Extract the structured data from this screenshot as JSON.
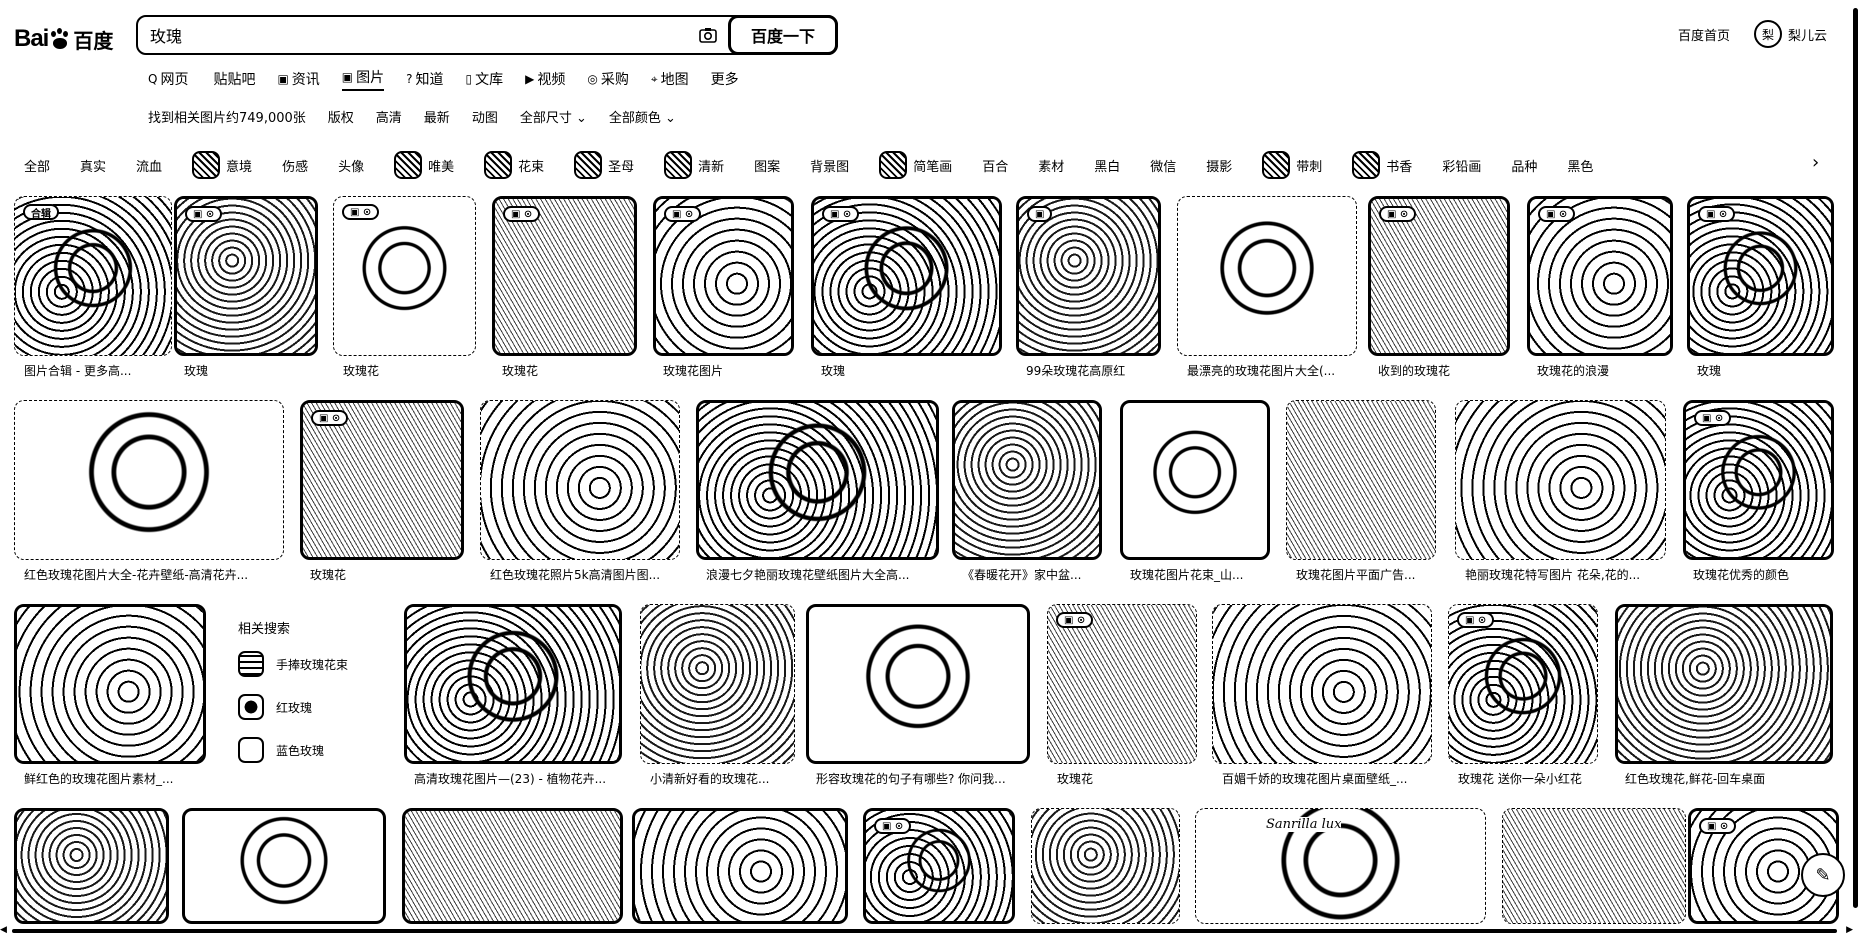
{
  "logo": {
    "bai": "Bai",
    "du": "百度"
  },
  "search": {
    "value": "玫瑰",
    "button_label": "百度一下"
  },
  "header": {
    "home_link": "百度首页",
    "username": "梨儿云",
    "avatar_text": "梨"
  },
  "nav": {
    "tabs": [
      {
        "label": "网页",
        "icon": "Q"
      },
      {
        "label": "贴贴吧",
        "icon": ""
      },
      {
        "label": "资讯",
        "icon": "▣"
      },
      {
        "label": "图片",
        "icon": "▣"
      },
      {
        "label": "知道",
        "icon": "?"
      },
      {
        "label": "文库",
        "icon": "▯"
      },
      {
        "label": "视频",
        "icon": "▶"
      },
      {
        "label": "采购",
        "icon": "◎"
      },
      {
        "label": "地图",
        "icon": "⌖"
      },
      {
        "label": "更多",
        "icon": ""
      }
    ]
  },
  "filters": {
    "result_count": "找到相关图片约749,000张",
    "items": [
      "版权",
      "高清",
      "最新",
      "动图",
      "全部尺寸 ⌄",
      "全部颜色 ⌄"
    ]
  },
  "tags": [
    {
      "label": "全部",
      "thumb": false
    },
    {
      "label": "真实",
      "thumb": false
    },
    {
      "label": "流血",
      "thumb": false
    },
    {
      "label": "意境",
      "thumb": true
    },
    {
      "label": "伤感",
      "thumb": false
    },
    {
      "label": "头像",
      "thumb": false
    },
    {
      "label": "唯美",
      "thumb": true
    },
    {
      "label": "花束",
      "thumb": true
    },
    {
      "label": "圣母",
      "thumb": true
    },
    {
      "label": "清新",
      "thumb": true
    },
    {
      "label": "图案",
      "thumb": false
    },
    {
      "label": "背景图",
      "thumb": false
    },
    {
      "label": "简笔画",
      "thumb": true
    },
    {
      "label": "百合",
      "thumb": false
    },
    {
      "label": "素材",
      "thumb": false
    },
    {
      "label": "黑白",
      "thumb": false
    },
    {
      "label": "微信",
      "thumb": false
    },
    {
      "label": "摄影",
      "thumb": false
    },
    {
      "label": "带刺",
      "thumb": true
    },
    {
      "label": "书香",
      "thumb": true
    },
    {
      "label": "彩铅画",
      "thumb": false
    },
    {
      "label": "品种",
      "thumb": false
    },
    {
      "label": "黑色",
      "thumb": false
    }
  ],
  "tags_arrow": "›",
  "row1": [
    {
      "caption": "图片合辑 - 更多高...",
      "badge": "合辑"
    },
    {
      "caption": "玫瑰",
      "badge": "▣ ⊙"
    },
    {
      "caption": "玫瑰花",
      "badge": "▣ ⊙"
    },
    {
      "caption": "玫瑰花",
      "badge": "▣ ⊙"
    },
    {
      "caption": "玫瑰花图片",
      "badge": "▣ ⊙"
    },
    {
      "caption": "玫瑰",
      "badge": "▣ ⊙"
    },
    {
      "caption": "99朵玫瑰花高原红",
      "badge": "▣"
    },
    {
      "caption": "最漂亮的玫瑰花图片大全(...",
      "badge": ""
    },
    {
      "caption": "收到的玫瑰花",
      "badge": "▣ ⊙"
    },
    {
      "caption": "玫瑰花的浪漫",
      "badge": "▣ ⊙"
    },
    {
      "caption": "玫瑰",
      "badge": "▣ ⊙"
    }
  ],
  "row2": [
    {
      "caption": "红色玫瑰花图片大全-花卉壁纸-高清花卉...",
      "badge": ""
    },
    {
      "caption": "玫瑰花",
      "badge": "▣ ⊙"
    },
    {
      "caption": "红色玫瑰花照片5k高清图片图...",
      "badge": ""
    },
    {
      "caption": "浪漫七夕艳丽玫瑰花壁纸图片大全高...",
      "badge": ""
    },
    {
      "caption": "《春暖花开》家中盆...",
      "badge": ""
    },
    {
      "caption": "玫瑰花图片花束_山...",
      "badge": ""
    },
    {
      "caption": "玫瑰花图片平面广告...",
      "badge": ""
    },
    {
      "caption": "艳丽玫瑰花特写图片 花朵,花的...",
      "badge": ""
    },
    {
      "caption": "玫瑰花优秀的颜色",
      "badge": "▣ ⊙"
    }
  ],
  "row3": [
    {
      "caption": "鲜红色的玫瑰花图片素材_...",
      "badge": ""
    },
    {
      "caption": "高清玫瑰花图片—(23) - 植物花卉...",
      "badge": ""
    },
    {
      "caption": "小清新好看的玫瑰花...",
      "badge": ""
    },
    {
      "caption": "形容玫瑰花的句子有哪些? 你问我...",
      "badge": ""
    },
    {
      "caption": "玫瑰花",
      "badge": "▣ ⊙"
    },
    {
      "caption": "百媚千娇的玫瑰花图片桌面壁纸_...",
      "badge": ""
    },
    {
      "caption": "玫瑰花 送你一朵小红花",
      "badge": "▣ ⊙"
    },
    {
      "caption": "红色玫瑰花,鲜花-回车桌面",
      "badge": ""
    }
  ],
  "related": {
    "title": "相关搜索",
    "items": [
      "手捧玫瑰花束",
      "红玫瑰",
      "蓝色玫瑰"
    ]
  },
  "row4_signature": "Sanrilla lux",
  "row4_badge": "▣ ⊙",
  "feedback_icon": "✎"
}
